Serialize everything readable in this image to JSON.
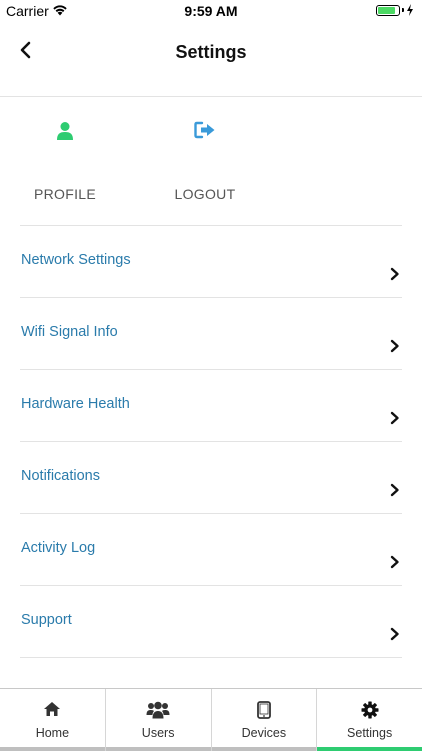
{
  "status_bar": {
    "carrier": "Carrier",
    "time": "9:59 AM",
    "battery_level": 0.85,
    "battery_color": "#4cd964"
  },
  "header": {
    "title": "Settings",
    "back_icon": "chevron-left-icon"
  },
  "quick_actions": [
    {
      "label": "PROFILE",
      "icon": "user-icon",
      "color": "#2ecc71"
    },
    {
      "label": "LOGOUT",
      "icon": "sign-out-icon",
      "color": "#3a9ad9"
    }
  ],
  "menu": {
    "item_color": "#2a7bab",
    "items": [
      {
        "label": "Network Settings"
      },
      {
        "label": "Wifi Signal Info"
      },
      {
        "label": "Hardware Health"
      },
      {
        "label": "Notifications"
      },
      {
        "label": "Activity Log"
      },
      {
        "label": "Support"
      }
    ]
  },
  "tab_bar": {
    "active_color": "#2ecc71",
    "tabs": [
      {
        "label": "Home",
        "icon": "home-icon",
        "active": false
      },
      {
        "label": "Users",
        "icon": "users-icon",
        "active": false
      },
      {
        "label": "Devices",
        "icon": "tablet-icon",
        "active": false
      },
      {
        "label": "Settings",
        "icon": "gear-icon",
        "active": true
      }
    ]
  }
}
